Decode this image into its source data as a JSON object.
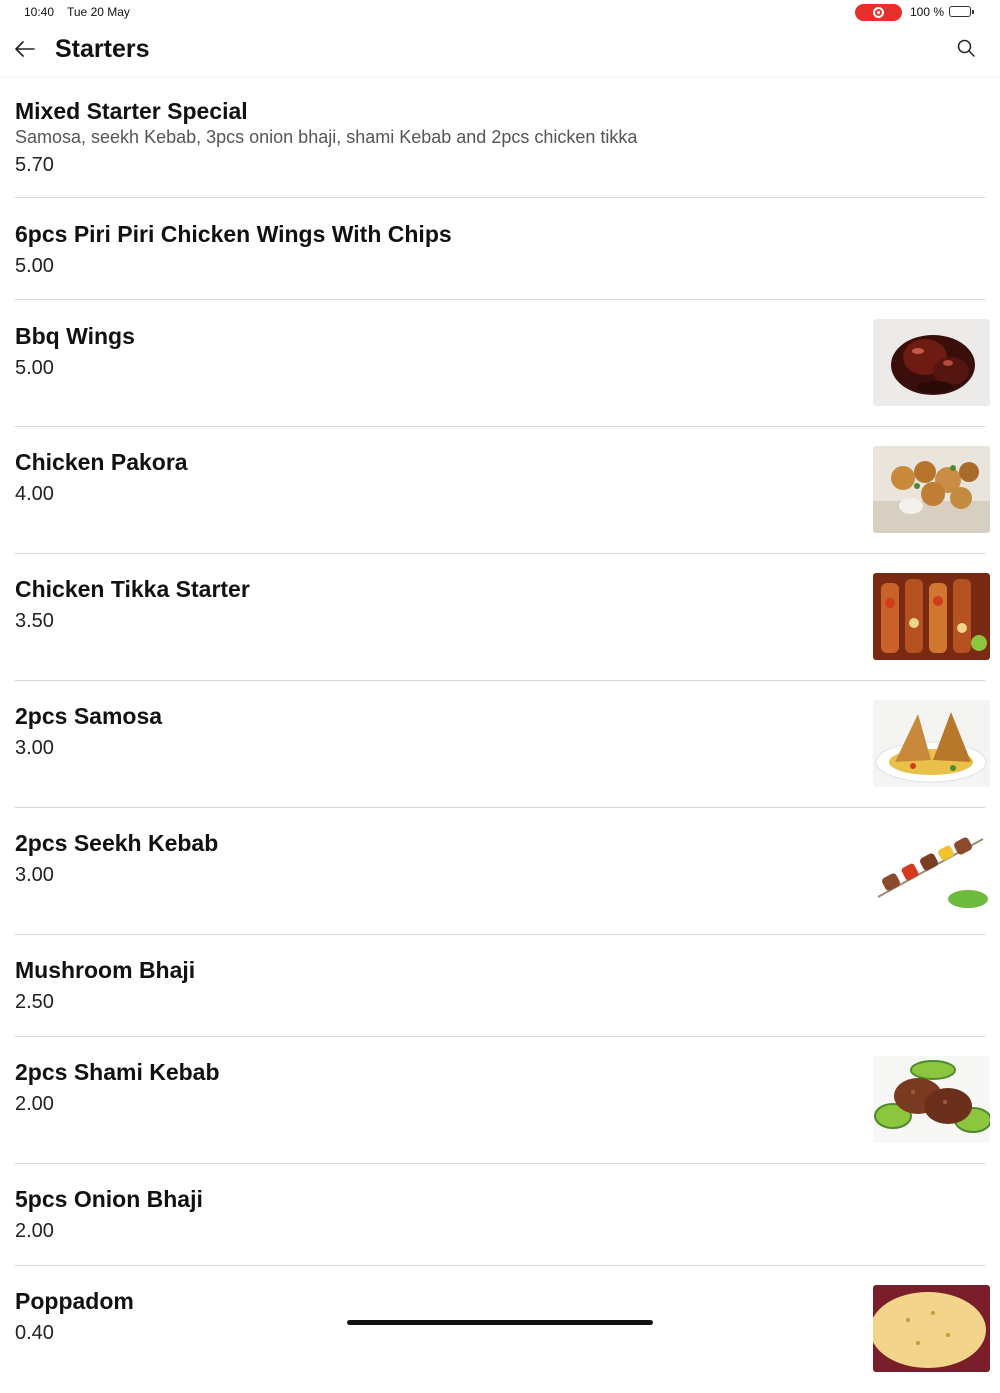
{
  "status_bar": {
    "time": "10:40",
    "date": "Tue 20 May",
    "battery": "100 %",
    "record_color": "#e8302b",
    "battery_color": "#35c759"
  },
  "header": {
    "title": "Starters",
    "back_icon": "arrow-left-icon",
    "search_icon": "search-icon"
  },
  "items": [
    {
      "name": "Mixed Starter Special",
      "description": "Samosa, seekh Kebab, 3pcs onion bhaji, shami Kebab and 2pcs chicken tikka",
      "price": "5.70",
      "image": null
    },
    {
      "name": "6pcs Piri Piri Chicken Wings With Chips",
      "description": "",
      "price": "5.00",
      "image": null
    },
    {
      "name": "Bbq Wings",
      "description": "",
      "price": "5.00",
      "image": "bbq-wings"
    },
    {
      "name": "Chicken Pakora",
      "description": "",
      "price": "4.00",
      "image": "chicken-pakora"
    },
    {
      "name": "Chicken Tikka Starter",
      "description": "",
      "price": "3.50",
      "image": "chicken-tikka"
    },
    {
      "name": "2pcs Samosa",
      "description": "",
      "price": "3.00",
      "image": "samosa"
    },
    {
      "name": "2pcs Seekh Kebab",
      "description": "",
      "price": "3.00",
      "image": "seekh-kebab"
    },
    {
      "name": "Mushroom Bhaji",
      "description": "",
      "price": "2.50",
      "image": null
    },
    {
      "name": "2pcs Shami Kebab",
      "description": "",
      "price": "2.00",
      "image": "shami-kebab"
    },
    {
      "name": "5pcs Onion Bhaji",
      "description": "",
      "price": "2.00",
      "image": null
    },
    {
      "name": "Poppadom",
      "description": "",
      "price": "0.40",
      "image": "poppadom"
    }
  ]
}
